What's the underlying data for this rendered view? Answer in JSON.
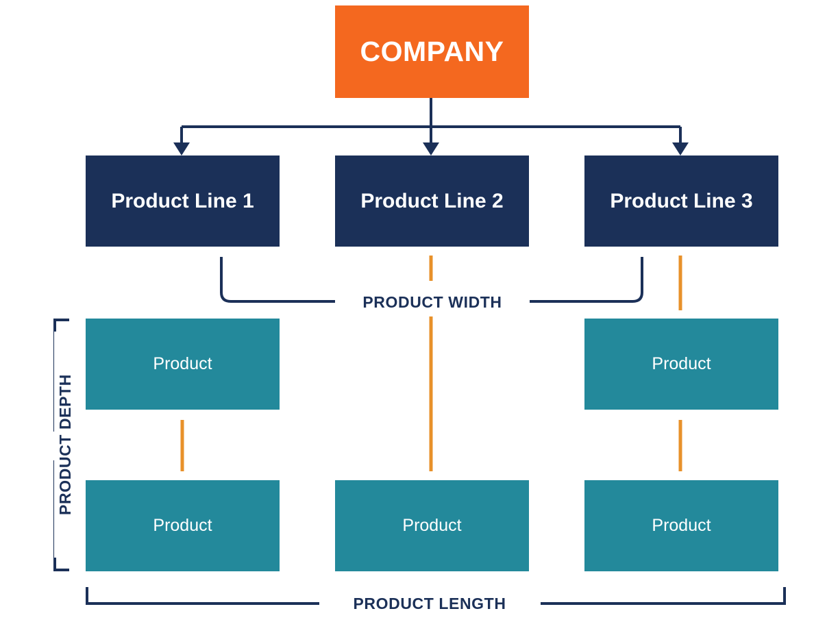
{
  "diagram": {
    "title_node": {
      "label": "COMPANY",
      "color": "#F4681F"
    },
    "product_lines": [
      {
        "label": "Product Line 1",
        "color": "#1B3058"
      },
      {
        "label": "Product Line 2",
        "color": "#1B3058"
      },
      {
        "label": "Product Line 3",
        "color": "#1B3058"
      }
    ],
    "products": {
      "row1": [
        {
          "label": "Product",
          "color": "#23899B",
          "visible": true
        },
        {
          "label": "",
          "color": "#23899B",
          "visible": false
        },
        {
          "label": "Product",
          "color": "#23899B",
          "visible": true
        }
      ],
      "row2": [
        {
          "label": "Product",
          "color": "#23899B",
          "visible": true
        },
        {
          "label": "Product",
          "color": "#23899B",
          "visible": true
        },
        {
          "label": "Product",
          "color": "#23899B",
          "visible": true
        }
      ]
    },
    "measures": {
      "width_label": "PRODUCT WIDTH",
      "depth_label": "PRODUCT DEPTH",
      "length_label": "PRODUCT LENGTH"
    },
    "colors": {
      "orange": "#F4681F",
      "navy": "#1B3058",
      "teal": "#23899B",
      "connector_orange": "#E8912A",
      "background": "#FFFFFF"
    }
  }
}
